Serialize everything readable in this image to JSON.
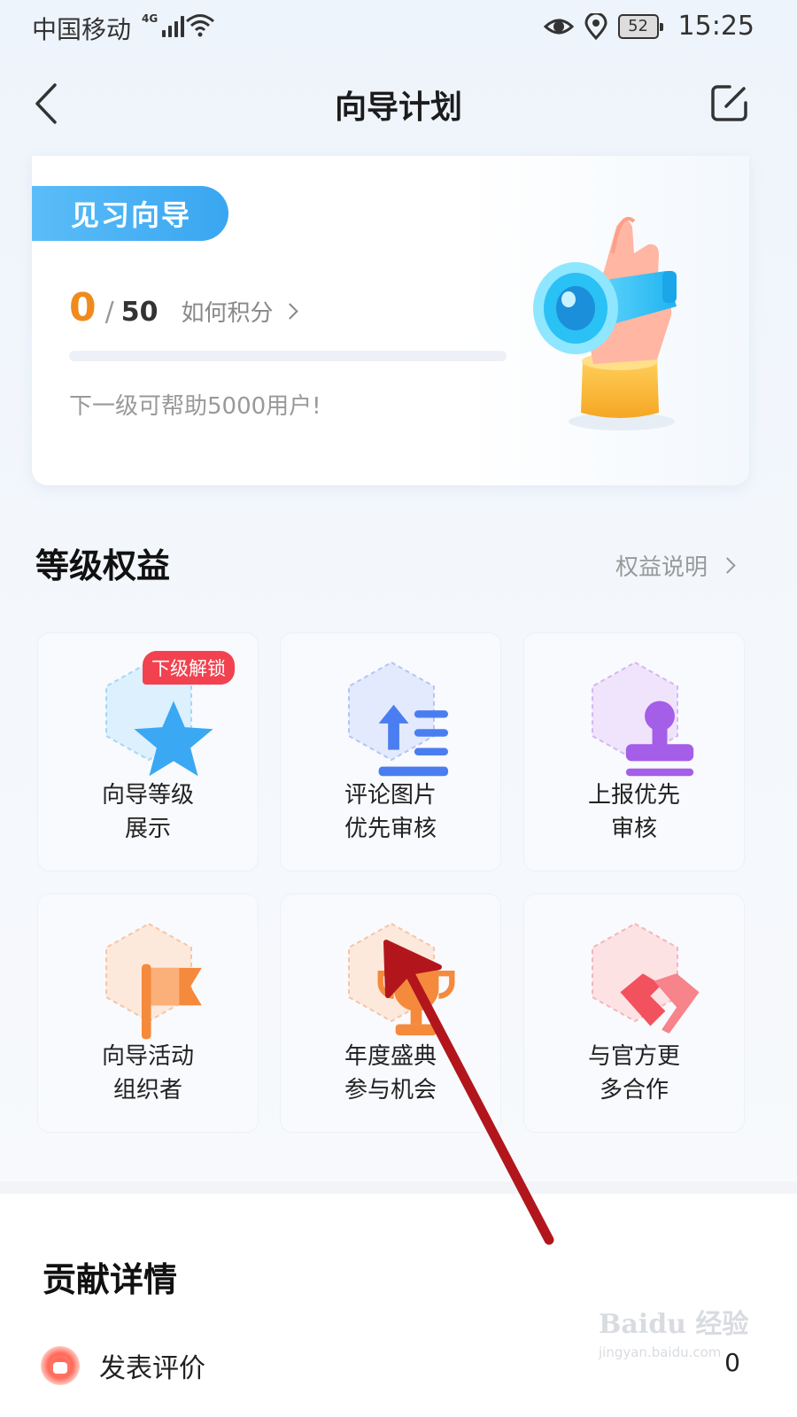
{
  "status": {
    "carrier": "中国移动",
    "network": "4G",
    "battery": "52",
    "time": "15:25"
  },
  "header": {
    "title": "向导计划"
  },
  "level_card": {
    "badge": "见习向导",
    "current_points": "0",
    "separator": "/",
    "total_points": "50",
    "progress_fraction": 0,
    "how_link": "如何积分",
    "next_level_desc": "下一级可帮助5000用户!"
  },
  "benefits_section": {
    "title": "等级权益",
    "link": "权益说明",
    "items": [
      {
        "line1": "向导等级",
        "line2": "展示",
        "icon": "star-icon",
        "color": "#3aa8f2",
        "tag": "下级解锁"
      },
      {
        "line1": "评论图片",
        "line2": "优先审核",
        "icon": "priority-list-icon",
        "color": "#4a7ef0"
      },
      {
        "line1": "上报优先",
        "line2": "审核",
        "icon": "stamp-icon",
        "color": "#a45ee8"
      },
      {
        "line1": "向导活动",
        "line2": "组织者",
        "icon": "flag-icon",
        "color": "#f58a3c"
      },
      {
        "line1": "年度盛典",
        "line2": "参与机会",
        "icon": "trophy-icon",
        "color": "#f58a3c"
      },
      {
        "line1": "与官方更",
        "line2": "多合作",
        "icon": "handshake-icon",
        "color": "#f2525e"
      }
    ]
  },
  "contribution": {
    "title": "贡献详情",
    "items": [
      {
        "label": "发表评价",
        "count": "0",
        "icon": "comment-icon"
      }
    ]
  },
  "watermark": {
    "main": "Baidu 经验",
    "sub": "jingyan.baidu.com"
  },
  "colors": {
    "accent_orange": "#f08a1c",
    "badge_blue": "#39a6f1",
    "unlock_red": "#f2424f",
    "annotation_arrow": "#b2161c"
  }
}
